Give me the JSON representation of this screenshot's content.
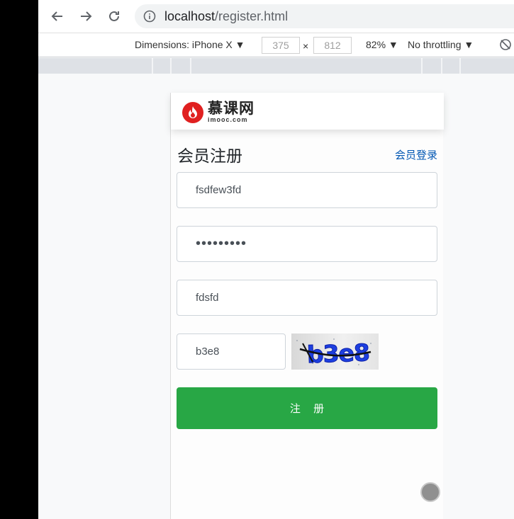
{
  "browser": {
    "url_host": "localhost",
    "url_path": "/register.html"
  },
  "device_toolbar": {
    "dimensions_label": "Dimensions: iPhone X ▼",
    "width": "375",
    "times": "×",
    "height": "812",
    "zoom": "82% ▼",
    "throttling": "No throttling ▼"
  },
  "header": {
    "logo_cn": "慕课网",
    "logo_en": "imooc.com"
  },
  "form": {
    "title": "会员注册",
    "login_link": "会员登录",
    "username_value": "fsdfew3fd",
    "password_value": "•••••••••",
    "nickname_value": "fdsfd",
    "captcha_value": "b3e8",
    "captcha_image_text": "b3e8",
    "submit_label": "注 册"
  },
  "colors": {
    "submit_bg": "#28a745",
    "link": "#0056b3",
    "logo_red": "#e02020"
  }
}
